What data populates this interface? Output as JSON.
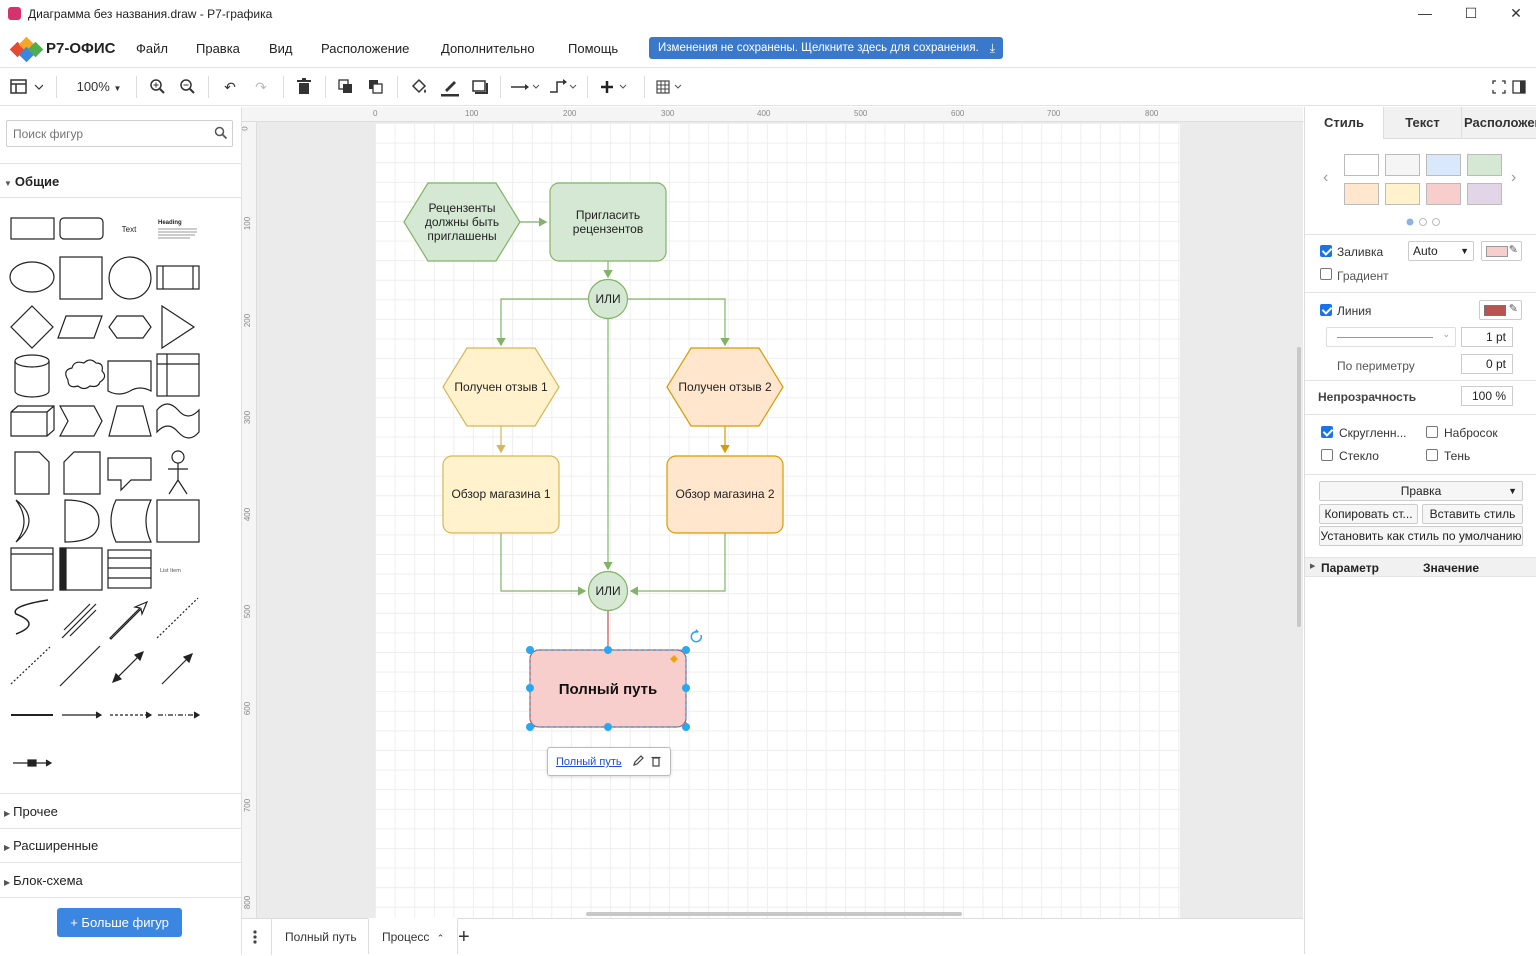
{
  "window": {
    "title": "Диаграмма без названия.draw - Р7-графика",
    "controls": {
      "minimize": "—",
      "maximize": "☐",
      "close": "✕"
    }
  },
  "menubar": {
    "logo_text": "Р7-ОФИС",
    "items": [
      "Файл",
      "Правка",
      "Вид",
      "Расположение",
      "Дополнительно",
      "Помощь"
    ],
    "save_banner": "Изменения не сохранены. Щелкните здесь для сохранения."
  },
  "toolbar": {
    "zoom": "100%"
  },
  "left_panel": {
    "search_placeholder": "Поиск фигур",
    "section_general": "Общие",
    "text_shape": "Text",
    "heading_shape": "Heading",
    "list_item_shape": "List Item",
    "sections_collapsed": [
      "Прочее",
      "Расширенные",
      "Блок-схема"
    ],
    "more_shapes": "+ Больше фигур"
  },
  "rulers": {
    "top": [
      "0",
      "100",
      "200",
      "300",
      "400",
      "500",
      "600",
      "700",
      "800"
    ],
    "left": [
      "0",
      "100",
      "200",
      "300",
      "400",
      "500",
      "600",
      "700",
      "800"
    ]
  },
  "diagram": {
    "nodes": {
      "reviewers_line1": "Рецензенты",
      "reviewers_line2": "должны быть",
      "reviewers_line3": "приглашены",
      "invite_line1": "Пригласить",
      "invite_line2": "рецензентов",
      "or_top": "ИЛИ",
      "review1": "Получен отзыв 1",
      "review2": "Получен отзыв 2",
      "store1": "Обзор магазина 1",
      "store2": "Обзор магазина 2",
      "or_bottom": "ИЛИ",
      "full_path": "Полный путь"
    },
    "link_popup": "Полный путь",
    "colors": {
      "green_fill": "#d5e8d4",
      "green_stroke": "#82b366",
      "yellow_fill": "#fff2cc",
      "yellow_stroke": "#d6b656",
      "orange_fill": "#ffe6cc",
      "orange_stroke": "#d79b00",
      "red_fill": "#f8cecc",
      "red_stroke": "#b85450",
      "selection": "#29a8ef"
    }
  },
  "page_tabs": [
    "Полный путь",
    "Процесс"
  ],
  "right_panel": {
    "tabs": [
      "Стиль",
      "Текст",
      "Расположение"
    ],
    "swatch_colors": [
      "#ffffff",
      "#f5f5f5",
      "#dae8fc",
      "#d5e8d4",
      "#ffe6cc",
      "#fff2cc",
      "#f8cecc",
      "#e1d5e7"
    ],
    "fill_label": "Заливка",
    "fill_mode": "Auto",
    "fill_color": "#f8cecc",
    "gradient_label": "Градиент",
    "line_label": "Линия",
    "line_color": "#b85450",
    "line_width": "1 pt",
    "perimeter_label": "По периметру",
    "perimeter_value": "0 pt",
    "opacity_label": "Непрозрачность",
    "opacity_value": "100 %",
    "rounded_label": "Скругленн...",
    "sketch_label": "Набросок",
    "glass_label": "Стекло",
    "shadow_label": "Тень",
    "edit_select": "Правка",
    "copy_style": "Копировать ст...",
    "paste_style": "Вставить стиль",
    "set_default": "Установить как стиль по умолчанию",
    "param_header": "Параметр",
    "value_header": "Значение"
  }
}
